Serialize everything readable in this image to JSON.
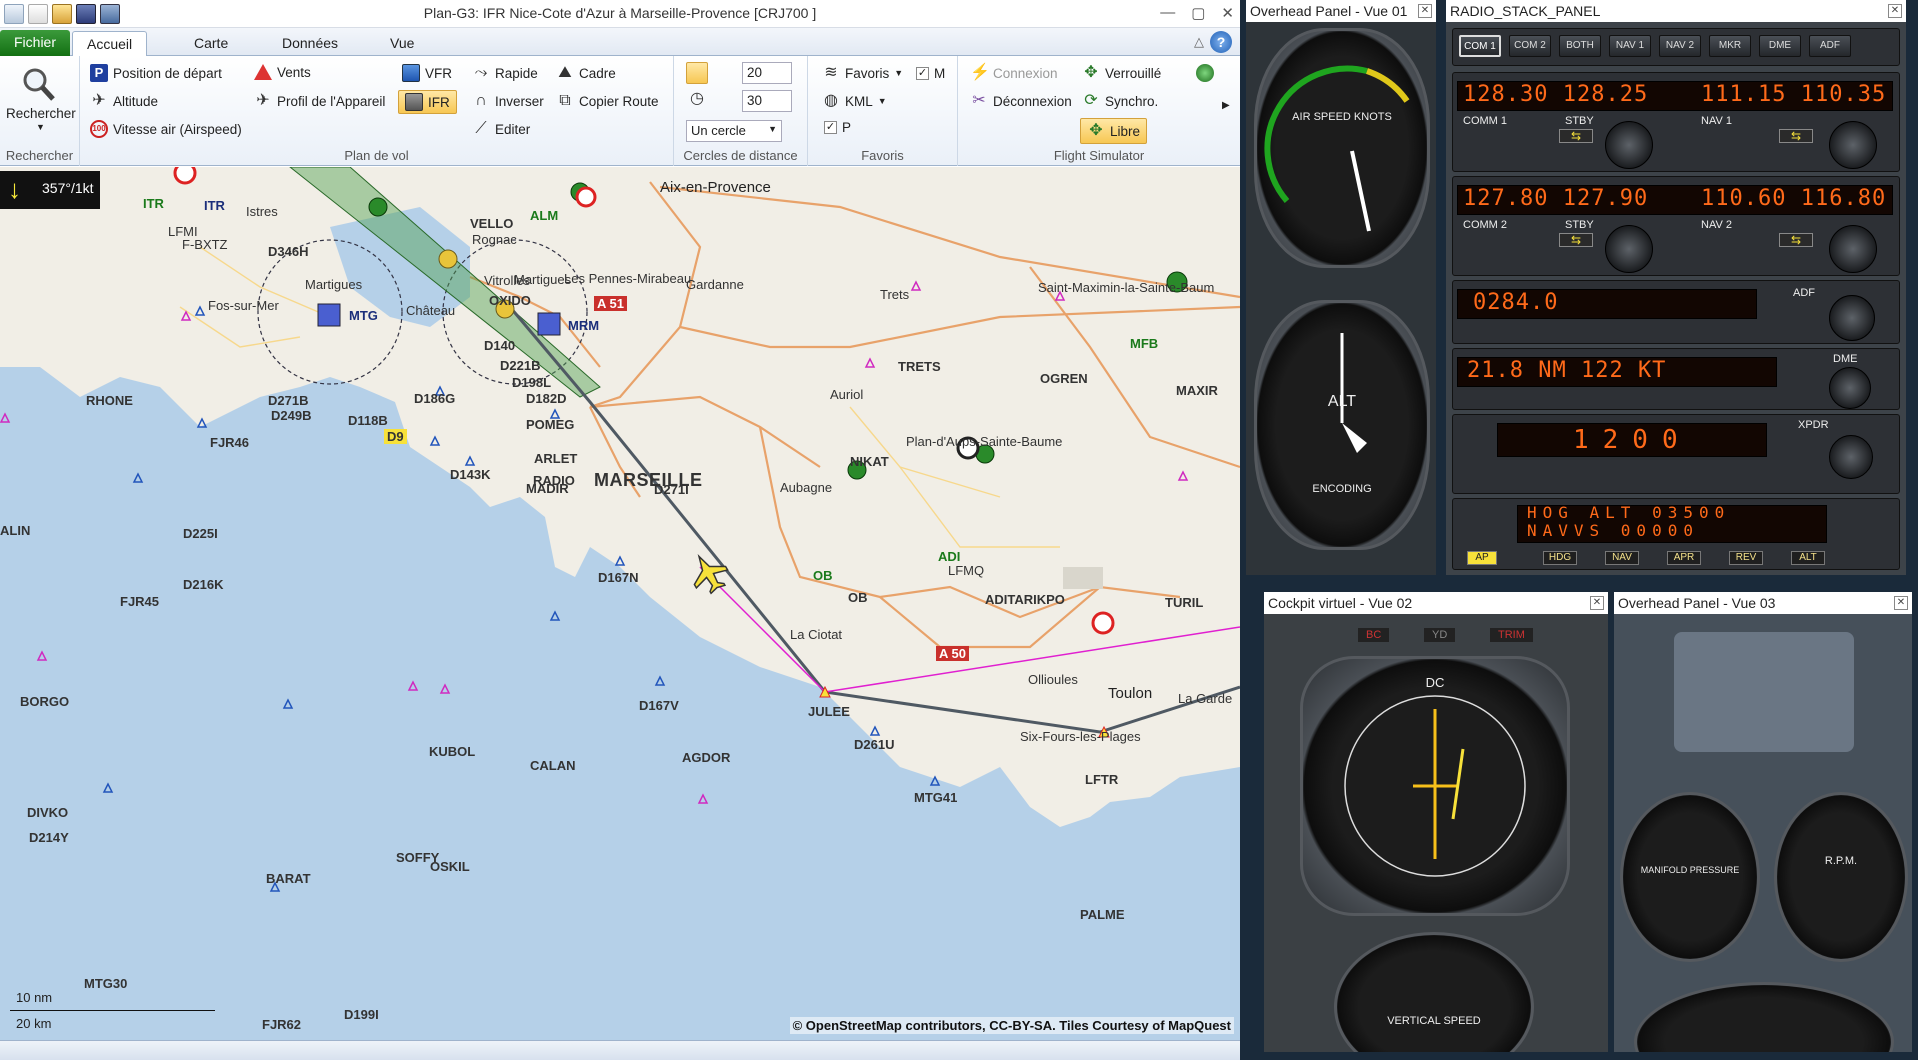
{
  "window": {
    "title": "Plan-G3: IFR Nice-Cote d'Azur à Marseille-Provence [CRJ700 ]",
    "minimize": "—",
    "maximize": "▢",
    "close": "✕"
  },
  "tabs": {
    "file": "Fichier",
    "home": "Accueil",
    "map": "Carte",
    "data": "Données",
    "view": "Vue"
  },
  "ribbon": {
    "search": {
      "label": "Rechercher",
      "group": "Rechercher"
    },
    "flightplan": {
      "group": "Plan de vol",
      "start_position": "Position de départ",
      "altitude": "Altitude",
      "airspeed": "Vitesse air (Airspeed)",
      "winds": "Vents",
      "aircraft_profile": "Profil de l'Appareil",
      "vfr": "VFR",
      "ifr": "IFR",
      "fast": "Rapide",
      "reverse": "Inverser",
      "edit": "Editer",
      "frame": "Cadre",
      "copy_route": "Copier Route"
    },
    "distance_circles": {
      "group": "Cercles de distance",
      "value1": "20",
      "value2": "30",
      "shape": "Un cercle"
    },
    "favorites": {
      "group": "Favoris",
      "favorites": "Favoris",
      "kml": "KML",
      "m_label": "M",
      "p_label": "P"
    },
    "flight_sim": {
      "group": "Flight Simulator",
      "connect": "Connexion",
      "disconnect": "Déconnexion",
      "lock": "Verrouillé",
      "sync": "Synchro.",
      "free": "Libre"
    }
  },
  "map": {
    "wind": "357°/1kt",
    "copyright": "© OpenStreetMap contributors, CC-BY-SA. Tiles Courtesy of MapQuest",
    "scale_nm": "10 nm",
    "scale_km": "20 km",
    "labels": {
      "aix": "Aix-en-Provence",
      "marseille": "MARSEILLE",
      "toulon": "Toulon",
      "gardanne": "Gardanne",
      "trets": "Trets",
      "trets_fix": "TRETS",
      "st_maximin": "Saint-Maximin-la-Sainte-Baum",
      "ogren": "OGREN",
      "maxir": "MAXIR",
      "mfb": "MFB",
      "auriol": "Auriol",
      "plan_aups": "Plan-d'Aups-Sainte-Baume",
      "nikat": "NIKAT",
      "aubagne": "Aubagne",
      "adi": "ADI",
      "lfmq": "LFMQ",
      "aditarikpo": "ADITARIKPO",
      "turil": "TURIL",
      "ob1": "OB",
      "ob2": "OB",
      "la_ciotat": "La Ciotat",
      "a50": "A 50",
      "a51": "A 51",
      "ollioules": "Ollioules",
      "six_fours": "Six-Fours-les-Plages",
      "la_garde": "La Garde",
      "lftr": "LFTR",
      "palme": "PALME",
      "julee": "JULEE",
      "d261u": "D261U",
      "agdor": "AGDOR",
      "mtg41": "MTG41",
      "d167v": "D167V",
      "d167n": "D167N",
      "d271i": "D271I",
      "arlet": "ARLET",
      "radio": "RADIO",
      "madir": "MADIR",
      "pomeg": "POMEG",
      "d143k": "D143K",
      "d186g": "D186G",
      "d182d": "D182D",
      "d198l": "D198L",
      "d221b": "D221B",
      "d140": "D140",
      "mrm": "MRM",
      "mtg": "MTG",
      "martigues1": "Martigues",
      "martigues2": "Martigues",
      "chateau": "Château",
      "les_pennes": "Les Pennes-Mirabeau",
      "vitrolles": "Vitrolles",
      "oxido": "OXIDO",
      "rognac": "Rognac",
      "vello": "VELLO",
      "alm": "ALM",
      "istres": "Istres",
      "itr1": "ITR",
      "itr2": "ITR",
      "lfmi": "LFMI",
      "fbxtz": "F-BXTZ",
      "d346h": "D346H",
      "fos": "Fos-sur-Mer",
      "rhone": "RHONE",
      "fjr46": "FJR46",
      "d249b": "D249B",
      "d271b": "D271B",
      "d118b": "D118B",
      "d9": "D9",
      "alin": "ALIN",
      "d225i": "D225I",
      "d216k": "D216K",
      "fjr45": "FJR45",
      "borgo": "BORGO",
      "kubol": "KUBOL",
      "calan": "CALAN",
      "divko": "DIVKO",
      "d214y": "D214Y",
      "barat": "BARAT",
      "soffy": "SOFFY",
      "oskil": "OSKIL",
      "mtg30": "MTG30",
      "fjr62": "FJR62",
      "d199i": "D199I"
    }
  },
  "panels": {
    "overhead1": {
      "title": "Overhead Panel - Vue 01",
      "asi": "AIR SPEED KNOTS",
      "alt": "ALT",
      "enc": "ENCODING"
    },
    "radio": {
      "title": "RADIO_STACK_PANEL",
      "tabs": [
        "COM 1",
        "COM 2",
        "BOTH",
        "NAV 1",
        "NAV 2",
        "MKR",
        "DME",
        "ADF"
      ],
      "com1": "128.30 128.25",
      "nav1": "111.15 110.35",
      "com2": "127.80 127.90",
      "nav2": "110.60 116.80",
      "adf": "0284.0",
      "dme": "21.8 NM  122 KT",
      "xpdr": "1200",
      "ap_line1": "HOG ALT   03500",
      "ap_line2": "NAVVS     00000",
      "ap_buttons": [
        "AP",
        "HDG",
        "NAV",
        "APR",
        "REV",
        "ALT"
      ],
      "comm1": "COMM 1",
      "comm2": "COMM 2",
      "stby": "STBY",
      "nav1_lbl": "NAV 1",
      "nav2_lbl": "NAV 2",
      "xpdr_lbl": "XPDR",
      "dme_lbl": "DME",
      "adf_lbl": "ADF"
    },
    "cockpit": {
      "title": "Cockpit virtuel - Vue 02",
      "dc": "DC",
      "vs": "VERTICAL SPEED",
      "bc": "BC",
      "yd": "YD",
      "trim": "TRIM"
    },
    "overhead3": {
      "title": "Overhead Panel - Vue 03",
      "manifold": "MANIFOLD PRESSURE",
      "rpm": "R.P.M."
    }
  },
  "colors": {
    "accent_green": "#137013",
    "route_grey": "#4f5963",
    "route_magenta": "#e01fd0",
    "sea": "#b5d0e8",
    "land": "#f1eee6"
  }
}
